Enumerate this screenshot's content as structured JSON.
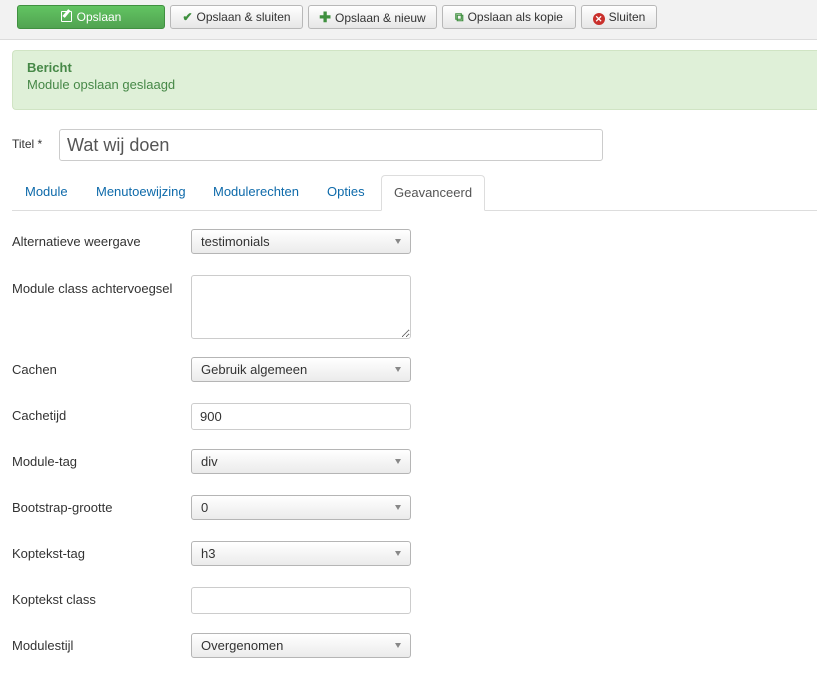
{
  "toolbar": {
    "save": "Opslaan",
    "save_close": "Opslaan & sluiten",
    "save_new": "Opslaan & nieuw",
    "save_copy": "Opslaan als kopie",
    "close": "Sluiten"
  },
  "alert": {
    "heading": "Bericht",
    "message": "Module opslaan geslaagd"
  },
  "title": {
    "label": "Titel *",
    "value": "Wat wij doen"
  },
  "tabs": [
    "Module",
    "Menutoewijzing",
    "Modulerechten",
    "Opties",
    "Geavanceerd"
  ],
  "active_tab": "Geavanceerd",
  "fields": {
    "layout": {
      "label": "Alternatieve weergave",
      "value": "testimonials"
    },
    "moduleclass_sfx": {
      "label": "Module class achtervoegsel",
      "value": ""
    },
    "cache": {
      "label": "Cachen",
      "value": "Gebruik algemeen"
    },
    "cache_time": {
      "label": "Cachetijd",
      "value": "900"
    },
    "module_tag": {
      "label": "Module-tag",
      "value": "div"
    },
    "bootstrap_size": {
      "label": "Bootstrap-grootte",
      "value": "0"
    },
    "header_tag": {
      "label": "Koptekst-tag",
      "value": "h3"
    },
    "header_class": {
      "label": "Koptekst class",
      "value": ""
    },
    "style": {
      "label": "Modulestijl",
      "value": "Overgenomen"
    }
  },
  "colors": {
    "primary_button": "#51a351",
    "alert_bg": "#dff0d8",
    "alert_text": "#468847",
    "tab_link": "#0e6aaa"
  }
}
